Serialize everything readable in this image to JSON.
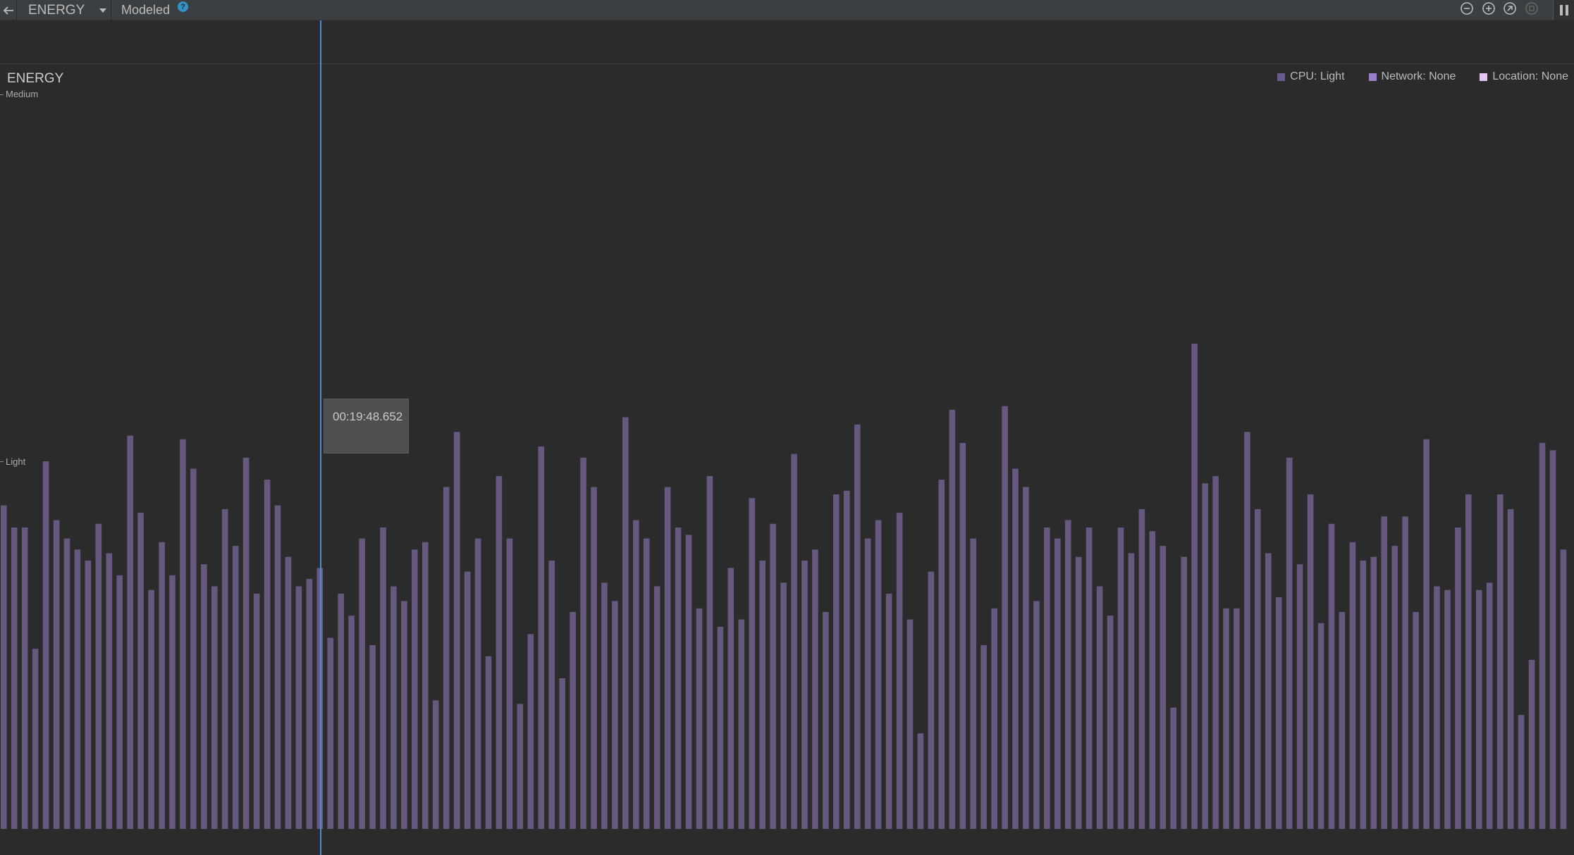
{
  "toolbar": {
    "back_icon": "arrow-left-icon",
    "monitor": "ENERGY",
    "monitor_dropdown_icon": "caret-down-icon",
    "mode": "Modeled",
    "help_icon": "?",
    "zoom_out_icon": "zoom-out-icon",
    "zoom_in_icon": "zoom-in-icon",
    "reset_zoom_icon": "reset-zoom-icon",
    "live_icon": "live-icon",
    "pause_icon": "pause-icon"
  },
  "chart": {
    "title": "ENERGY",
    "y_labels": {
      "medium": "Medium",
      "light": "Light"
    },
    "tooltip": "00:19:48.652"
  },
  "legend": [
    {
      "label": "CPU: Light",
      "color": "#6a5a8c"
    },
    {
      "label": "Network: None",
      "color": "#9a7fc7"
    },
    {
      "label": "Location: None",
      "color": "#e5c5f5"
    }
  ],
  "colors": {
    "bar": "#66587f",
    "cursor": "#4a90d9",
    "background": "#2b2b2b",
    "toolbar": "#3c3f41"
  },
  "chart_data": {
    "type": "bar",
    "title": "ENERGY",
    "y_levels": [
      "None",
      "Light",
      "Medium"
    ],
    "y_scale": "Light = 1.0, Medium = 2.0",
    "series": [
      {
        "name": "CPU: Light",
        "values": [
          0.88,
          0.82,
          0.82,
          0.49,
          1.0,
          0.84,
          0.79,
          0.76,
          0.73,
          0.83,
          0.75,
          0.69,
          1.07,
          0.86,
          0.65,
          0.78,
          0.69,
          1.06,
          0.98,
          0.72,
          0.66,
          0.87,
          0.77,
          1.01,
          0.64,
          0.95,
          0.88,
          0.74,
          0.66,
          0.68,
          0.71,
          0.52,
          0.64,
          0.58,
          0.79,
          0.5,
          0.82,
          0.66,
          0.62,
          0.76,
          0.78,
          0.35,
          0.93,
          1.08,
          0.7,
          0.79,
          0.47,
          0.96,
          0.79,
          0.34,
          0.53,
          1.04,
          0.73,
          0.41,
          0.59,
          1.01,
          0.93,
          0.67,
          0.62,
          1.12,
          0.84,
          0.79,
          0.66,
          0.93,
          0.82,
          0.8,
          0.6,
          0.96,
          0.55,
          0.71,
          0.57,
          0.9,
          0.73,
          0.83,
          0.67,
          1.02,
          0.73,
          0.76,
          0.59,
          0.91,
          0.92,
          1.1,
          0.79,
          0.84,
          0.64,
          0.86,
          0.57,
          0.26,
          0.7,
          0.95,
          1.14,
          1.05,
          0.79,
          0.5,
          0.6,
          1.15,
          0.98,
          0.93,
          0.62,
          0.82,
          0.79,
          0.84,
          0.74,
          0.82,
          0.66,
          0.58,
          0.82,
          0.75,
          0.87,
          0.81,
          0.77,
          0.33,
          0.74,
          1.32,
          0.94,
          0.96,
          0.6,
          0.6,
          1.08,
          0.87,
          0.75,
          0.63,
          1.01,
          0.72,
          0.91,
          0.56,
          0.83,
          0.59,
          0.78,
          0.73,
          0.74,
          0.85,
          0.77,
          0.85,
          0.59,
          1.06,
          0.66,
          0.65,
          0.82,
          0.91,
          0.65,
          0.67,
          0.91,
          0.87,
          0.31,
          0.46,
          1.05,
          1.03,
          0.76
        ]
      },
      {
        "name": "Network: None",
        "values": []
      },
      {
        "name": "Location: None",
        "values": []
      }
    ],
    "grid": false,
    "legend_position": "top-right"
  }
}
